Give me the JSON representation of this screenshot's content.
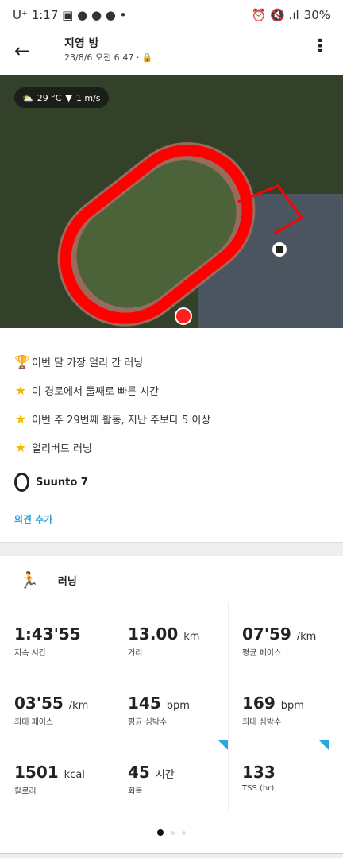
{
  "status": {
    "carrier": "U⁺",
    "time": "1:17",
    "battery": "30%"
  },
  "header": {
    "title": "지영 방",
    "subtitle": "23/8/6 오전 6:47 ·"
  },
  "map": {
    "temperature": "29 °C",
    "wind": "1 m/s",
    "route_color": "#ff0000"
  },
  "achievements": [
    {
      "icon": "trophy-icon",
      "text": "이번 달 가장 멀리 간 러닝"
    },
    {
      "icon": "star-icon",
      "text": "이 경로에서 둘째로 빠른 시간"
    },
    {
      "icon": "star-icon",
      "text": "이번 주 29번째 활동, 지난 주보다 5 이상"
    },
    {
      "icon": "star-icon",
      "text": "얼리버드 러닝"
    }
  ],
  "device": "Suunto 7",
  "add_comment": "의견 추가",
  "activity": "러닝",
  "stats": [
    {
      "value": "1:43'55",
      "unit": "",
      "label": "지속 시간"
    },
    {
      "value": "13.00",
      "unit": "km",
      "label": "거리"
    },
    {
      "value": "07'59",
      "unit": "/km",
      "label": "평균 페이스"
    },
    {
      "value": "03'55",
      "unit": "/km",
      "label": "최대 페이스"
    },
    {
      "value": "145",
      "unit": "bpm",
      "label": "평균 심박수"
    },
    {
      "value": "169",
      "unit": "bpm",
      "label": "최대 심박수"
    },
    {
      "value": "1501",
      "unit": "kcal",
      "label": "칼로리"
    },
    {
      "value": "45",
      "unit": "시간",
      "label": "회복",
      "flag": true
    },
    {
      "value": "133",
      "unit": "",
      "label": "TSS (hr)",
      "flag": true
    }
  ],
  "pager": {
    "pages": 3,
    "current": 1
  },
  "colors": {
    "accent": "#2ea3d8",
    "star": "#f6b800"
  }
}
